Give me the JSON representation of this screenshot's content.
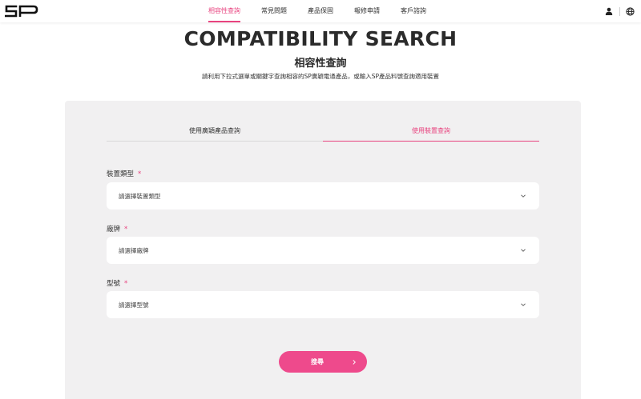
{
  "brand": {
    "logo_text": "SP",
    "accent": "#e8437f"
  },
  "nav": {
    "items": [
      {
        "label": "相容性查詢",
        "active": true
      },
      {
        "label": "常見問題",
        "active": false
      },
      {
        "label": "產品保固",
        "active": false
      },
      {
        "label": "報修申請",
        "active": false
      },
      {
        "label": "客戶諮詢",
        "active": false
      }
    ],
    "icons": [
      "user-icon",
      "globe-icon"
    ]
  },
  "header": {
    "title_en": "COMPATIBILITY SEARCH",
    "title_zh": "相容性查詢",
    "subtitle": "請利用下拉式選單或關鍵字查詢相容的SP廣穎電通產品，或輸入SP產品料號查詢適用裝置"
  },
  "tabs": [
    {
      "label": "使用廣穎產品查詢",
      "active": false
    },
    {
      "label": "使用裝置查詢",
      "active": true
    }
  ],
  "form": {
    "fields": [
      {
        "label": "裝置類型",
        "required_mark": "*",
        "placeholder": "請選擇裝置類型"
      },
      {
        "label": "廠牌",
        "required_mark": "*",
        "placeholder": "請選擇廠牌"
      },
      {
        "label": "型號",
        "required_mark": "*",
        "placeholder": "請選擇型號"
      }
    ],
    "submit_label": "搜尋"
  }
}
